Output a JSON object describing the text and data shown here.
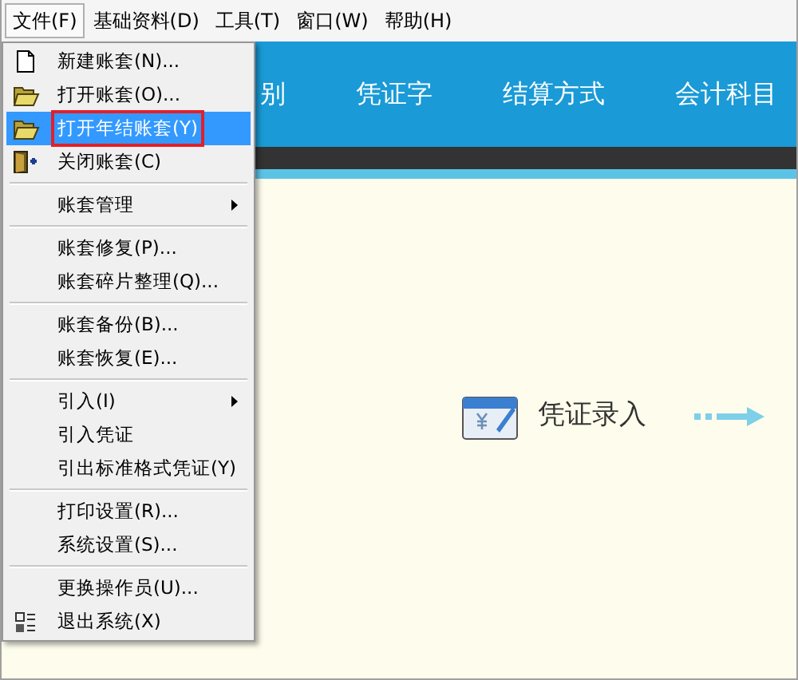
{
  "menubar": [
    {
      "label": "文件(F)",
      "selected": true
    },
    {
      "label": "基础资料(D)",
      "selected": false
    },
    {
      "label": "工具(T)",
      "selected": false
    },
    {
      "label": "窗口(W)",
      "selected": false
    },
    {
      "label": "帮助(H)",
      "selected": false
    }
  ],
  "header_tabs": [
    "别",
    "凭证字",
    "结算方式",
    "会计科目"
  ],
  "file_menu": [
    {
      "kind": "new",
      "label": "新建账套(N)...",
      "selected": false,
      "submenu": false
    },
    {
      "kind": "open",
      "label": "打开账套(O)...",
      "selected": false,
      "submenu": false
    },
    {
      "kind": "open",
      "label": "打开年结账套(Y)",
      "selected": true,
      "submenu": false
    },
    {
      "kind": "close",
      "label": "关闭账套(C)",
      "selected": false,
      "submenu": false
    },
    {
      "kind": "separator"
    },
    {
      "kind": "plain",
      "label": "账套管理",
      "selected": false,
      "submenu": true
    },
    {
      "kind": "separator"
    },
    {
      "kind": "plain",
      "label": "账套修复(P)...",
      "selected": false,
      "submenu": false
    },
    {
      "kind": "plain",
      "label": "账套碎片整理(Q)...",
      "selected": false,
      "submenu": false
    },
    {
      "kind": "separator"
    },
    {
      "kind": "plain",
      "label": "账套备份(B)...",
      "selected": false,
      "submenu": false
    },
    {
      "kind": "plain",
      "label": "账套恢复(E)...",
      "selected": false,
      "submenu": false
    },
    {
      "kind": "separator"
    },
    {
      "kind": "plain",
      "label": "引入(I)",
      "selected": false,
      "submenu": true
    },
    {
      "kind": "plain",
      "label": "引入凭证",
      "selected": false,
      "submenu": false
    },
    {
      "kind": "plain",
      "label": "引出标准格式凭证(Y)",
      "selected": false,
      "submenu": false
    },
    {
      "kind": "separator"
    },
    {
      "kind": "plain",
      "label": "打印设置(R)...",
      "selected": false,
      "submenu": false
    },
    {
      "kind": "plain",
      "label": "系统设置(S)...",
      "selected": false,
      "submenu": false
    },
    {
      "kind": "separator"
    },
    {
      "kind": "plain",
      "label": "更换操作员(U)...",
      "selected": false,
      "submenu": false
    },
    {
      "kind": "exit",
      "label": "退出系统(X)",
      "selected": false,
      "submenu": false
    }
  ],
  "workflow": {
    "label": "凭证录入"
  }
}
